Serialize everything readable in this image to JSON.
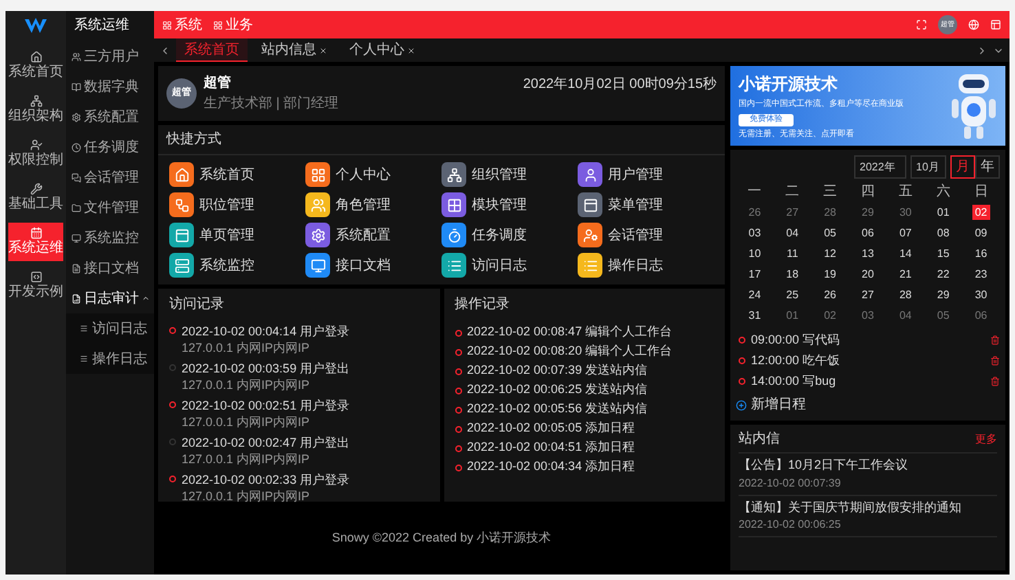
{
  "app": {
    "module_title": "系统运维"
  },
  "rail": [
    {
      "label": "系统首页",
      "selected": false
    },
    {
      "label": "组织架构",
      "selected": false
    },
    {
      "label": "权限控制",
      "selected": false
    },
    {
      "label": "基础工具",
      "selected": false
    },
    {
      "label": "系统运维",
      "selected": true
    },
    {
      "label": "开发示例",
      "selected": false
    }
  ],
  "submenu": [
    {
      "label": "三方用户",
      "expanded": false
    },
    {
      "label": "数据字典",
      "expanded": false
    },
    {
      "label": "系统配置",
      "expanded": false
    },
    {
      "label": "任务调度",
      "expanded": false
    },
    {
      "label": "会话管理",
      "expanded": false
    },
    {
      "label": "文件管理",
      "expanded": false
    },
    {
      "label": "系统监控",
      "expanded": false
    },
    {
      "label": "接口文档",
      "expanded": false
    },
    {
      "label": "日志审计",
      "expanded": true,
      "children": [
        {
          "label": "访问日志"
        },
        {
          "label": "操作日志"
        }
      ]
    }
  ],
  "topbar": {
    "modules": [
      "系统",
      "业务"
    ],
    "avatar": "超管"
  },
  "tabs": [
    {
      "label": "系统首页",
      "selected": true,
      "closable": false
    },
    {
      "label": "站内信息",
      "selected": false,
      "closable": true
    },
    {
      "label": "个人中心",
      "selected": false,
      "closable": true
    }
  ],
  "user_card": {
    "avatar": "超管",
    "name": "超管",
    "org": "生产技术部 | 部门经理",
    "datetime": "2022年10月02日 00时09分15秒"
  },
  "banner": {
    "title": "小诺开源技术",
    "subtitle": "国内一流中国式工作流、多租户等尽在商业版",
    "button": "免费体验",
    "tagline": "无需注册、无需关注、点开即看"
  },
  "shortcuts": {
    "title": "快捷方式",
    "items": [
      {
        "label": "系统首页",
        "color": "#f56c1d"
      },
      {
        "label": "个人中心",
        "color": "#f56c1d"
      },
      {
        "label": "组织管理",
        "color": "#5b6373"
      },
      {
        "label": "用户管理",
        "color": "#7b5ce0"
      },
      {
        "label": "职位管理",
        "color": "#f56c1d"
      },
      {
        "label": "角色管理",
        "color": "#f5b81d"
      },
      {
        "label": "模块管理",
        "color": "#7b5ce0"
      },
      {
        "label": "菜单管理",
        "color": "#5b6373"
      },
      {
        "label": "单页管理",
        "color": "#13a8a8"
      },
      {
        "label": "系统配置",
        "color": "#7b5ce0"
      },
      {
        "label": "任务调度",
        "color": "#1f8af5"
      },
      {
        "label": "会话管理",
        "color": "#f56c1d"
      },
      {
        "label": "系统监控",
        "color": "#13a8a8"
      },
      {
        "label": "接口文档",
        "color": "#1f8af5"
      },
      {
        "label": "访问日志",
        "color": "#13a8a8"
      },
      {
        "label": "操作日志",
        "color": "#f5b81d"
      }
    ]
  },
  "access_log": {
    "title": "访问记录",
    "items": [
      {
        "kind": "login",
        "time": "2022-10-02 00:04:14",
        "event": "用户登录",
        "detail": "127.0.0.1 内网IP内网IP"
      },
      {
        "kind": "logout",
        "time": "2022-10-02 00:03:59",
        "event": "用户登出",
        "detail": "127.0.0.1 内网IP内网IP"
      },
      {
        "kind": "login",
        "time": "2022-10-02 00:02:51",
        "event": "用户登录",
        "detail": "127.0.0.1 内网IP内网IP"
      },
      {
        "kind": "logout",
        "time": "2022-10-02 00:02:47",
        "event": "用户登出",
        "detail": "127.0.0.1 内网IP内网IP"
      },
      {
        "kind": "login",
        "time": "2022-10-02 00:02:33",
        "event": "用户登录",
        "detail": "127.0.0.1 内网IP内网IP"
      }
    ]
  },
  "operation_log": {
    "title": "操作记录",
    "items": [
      {
        "time": "2022-10-02 00:08:47",
        "event": "编辑个人工作台"
      },
      {
        "time": "2022-10-02 00:08:20",
        "event": "编辑个人工作台"
      },
      {
        "time": "2022-10-02 00:07:39",
        "event": "发送站内信"
      },
      {
        "time": "2022-10-02 00:06:25",
        "event": "发送站内信"
      },
      {
        "time": "2022-10-02 00:05:56",
        "event": "发送站内信"
      },
      {
        "time": "2022-10-02 00:05:05",
        "event": "添加日程"
      },
      {
        "time": "2022-10-02 00:04:51",
        "event": "添加日程"
      },
      {
        "time": "2022-10-02 00:04:34",
        "event": "添加日程"
      }
    ]
  },
  "footer": "Snowy ©2022 Created by 小诺开源技术",
  "calendar": {
    "year": "2022年",
    "month": "10月",
    "modes": [
      {
        "label": "月",
        "selected": true
      },
      {
        "label": "年",
        "selected": false
      }
    ],
    "weekdays": [
      "一",
      "二",
      "三",
      "四",
      "五",
      "六",
      "日"
    ],
    "days": [
      {
        "label": "26",
        "current": false,
        "selected": false
      },
      {
        "label": "27",
        "current": false,
        "selected": false
      },
      {
        "label": "28",
        "current": false,
        "selected": false
      },
      {
        "label": "29",
        "current": false,
        "selected": false
      },
      {
        "label": "30",
        "current": false,
        "selected": false
      },
      {
        "label": "01",
        "current": true,
        "selected": false
      },
      {
        "label": "02",
        "current": true,
        "selected": true
      },
      {
        "label": "03",
        "current": true,
        "selected": false
      },
      {
        "label": "04",
        "current": true,
        "selected": false
      },
      {
        "label": "05",
        "current": true,
        "selected": false
      },
      {
        "label": "06",
        "current": true,
        "selected": false
      },
      {
        "label": "07",
        "current": true,
        "selected": false
      },
      {
        "label": "08",
        "current": true,
        "selected": false
      },
      {
        "label": "09",
        "current": true,
        "selected": false
      },
      {
        "label": "10",
        "current": true,
        "selected": false
      },
      {
        "label": "11",
        "current": true,
        "selected": false
      },
      {
        "label": "12",
        "current": true,
        "selected": false
      },
      {
        "label": "13",
        "current": true,
        "selected": false
      },
      {
        "label": "14",
        "current": true,
        "selected": false
      },
      {
        "label": "15",
        "current": true,
        "selected": false
      },
      {
        "label": "16",
        "current": true,
        "selected": false
      },
      {
        "label": "17",
        "current": true,
        "selected": false
      },
      {
        "label": "18",
        "current": true,
        "selected": false
      },
      {
        "label": "19",
        "current": true,
        "selected": false
      },
      {
        "label": "20",
        "current": true,
        "selected": false
      },
      {
        "label": "21",
        "current": true,
        "selected": false
      },
      {
        "label": "22",
        "current": true,
        "selected": false
      },
      {
        "label": "23",
        "current": true,
        "selected": false
      },
      {
        "label": "24",
        "current": true,
        "selected": false
      },
      {
        "label": "25",
        "current": true,
        "selected": false
      },
      {
        "label": "26",
        "current": true,
        "selected": false
      },
      {
        "label": "27",
        "current": true,
        "selected": false
      },
      {
        "label": "28",
        "current": true,
        "selected": false
      },
      {
        "label": "29",
        "current": true,
        "selected": false
      },
      {
        "label": "30",
        "current": true,
        "selected": false
      },
      {
        "label": "31",
        "current": true,
        "selected": false
      },
      {
        "label": "01",
        "current": false,
        "selected": false
      },
      {
        "label": "02",
        "current": false,
        "selected": false
      },
      {
        "label": "03",
        "current": false,
        "selected": false
      },
      {
        "label": "04",
        "current": false,
        "selected": false
      },
      {
        "label": "05",
        "current": false,
        "selected": false
      },
      {
        "label": "06",
        "current": false,
        "selected": false
      }
    ],
    "schedule": [
      {
        "time": "09:00:00",
        "text": "写代码"
      },
      {
        "time": "12:00:00",
        "text": "吃午饭"
      },
      {
        "time": "14:00:00",
        "text": "写bug"
      }
    ],
    "add_button": "新增日程"
  },
  "messages": {
    "title": "站内信",
    "more": "更多",
    "items": [
      {
        "text": "【公告】10月2日下午工作会议",
        "time": "2022-10-02 00:07:39"
      },
      {
        "text": "【通知】关于国庆节期间放假安排的通知",
        "time": "2022-10-02 00:06:25"
      }
    ]
  }
}
